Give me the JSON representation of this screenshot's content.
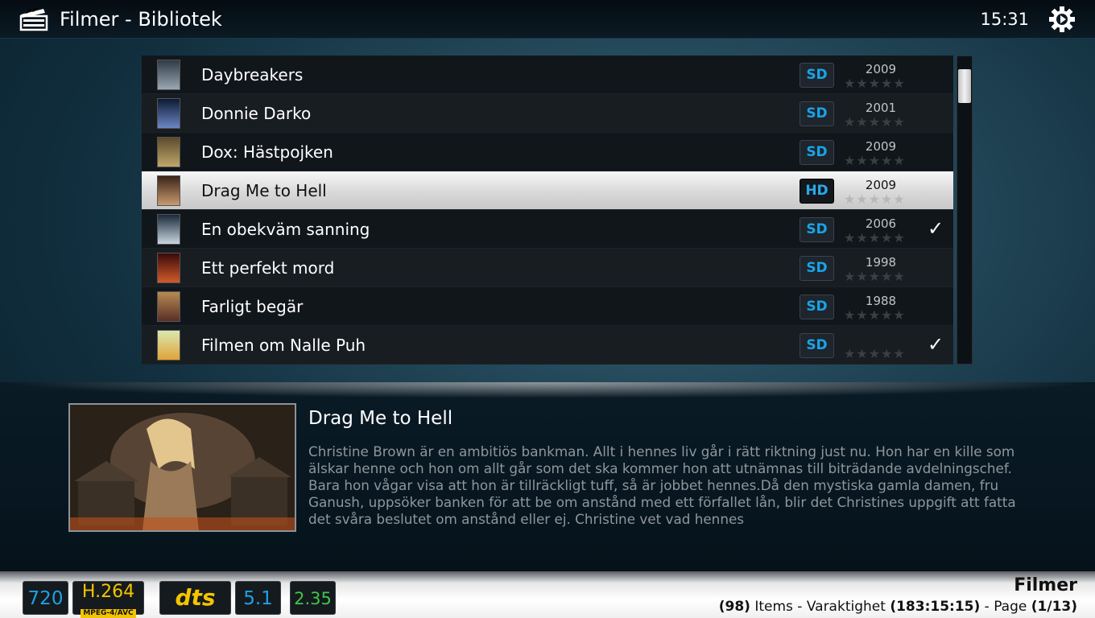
{
  "header": {
    "title": "Filmer - Bibliotek",
    "clock": "15:31",
    "app_icon": "clapperboard-icon",
    "settings_icon": "gear-icon"
  },
  "list": {
    "items": [
      {
        "title": "Daybreakers",
        "quality": "SD",
        "year": "2009",
        "rating": 0,
        "watched": false,
        "poster_colors": [
          "#2f3b46",
          "#9aa8b3"
        ]
      },
      {
        "title": "Donnie Darko",
        "quality": "SD",
        "year": "2001",
        "rating": 0,
        "watched": false,
        "poster_colors": [
          "#0d1a33",
          "#6c87c4"
        ]
      },
      {
        "title": "Dox: Hästpojken",
        "quality": "SD",
        "year": "2009",
        "rating": 0,
        "watched": false,
        "poster_colors": [
          "#5c4a2d",
          "#c0a76a"
        ]
      },
      {
        "title": "Drag Me to Hell",
        "quality": "HD",
        "year": "2009",
        "rating": 0,
        "watched": false,
        "selected": true,
        "poster_colors": [
          "#3a2418",
          "#c99a6e"
        ]
      },
      {
        "title": "En obekväm sanning",
        "quality": "SD",
        "year": "2006",
        "rating": 0,
        "watched": true,
        "poster_colors": [
          "#1a2a3a",
          "#c9d6e0"
        ]
      },
      {
        "title": "Ett perfekt mord",
        "quality": "SD",
        "year": "1998",
        "rating": 0,
        "watched": false,
        "poster_colors": [
          "#3a0a0a",
          "#d15a2a"
        ]
      },
      {
        "title": "Farligt begär",
        "quality": "SD",
        "year": "1988",
        "rating": 0,
        "watched": false,
        "poster_colors": [
          "#b48a53",
          "#5a2f26"
        ]
      },
      {
        "title": "Filmen om Nalle Puh",
        "quality": "SD",
        "year": "",
        "rating": 0,
        "watched": true,
        "poster_colors": [
          "#d9e8b0",
          "#e0a33a"
        ]
      }
    ],
    "star_glyphs": "★★★★★",
    "watched_glyph": "✓"
  },
  "info": {
    "title": "Drag Me to Hell",
    "plot": "Christine Brown är en ambitiös bankman. Allt i hennes liv går i rätt riktning just nu. Hon har en kille som älskar henne och hon om allt går som det ska kommer hon att utnämnas till biträdande avdelningschef. Bara hon vågar visa att hon är tillräckligt tuff, så är jobbet hennes.Då den mystiska gamla damen, fru Ganush, uppsöker banken för att be om anstånd med ett förfallet lån, blir det Christines uppgift att fatta det svåra beslutet om anstånd eller ej. Christine vet vad hennes"
  },
  "footer": {
    "flags": {
      "resolution": "720",
      "codec": "H.264",
      "codec_sub": "MPEG-4/AVC",
      "audio": "dts",
      "channels": "5.1",
      "aspect": "2.35"
    },
    "section": "Filmer",
    "items_count": "(98)",
    "items_label": "Items - Varaktighet",
    "duration": "(183:15:15)",
    "page_label": "- Page",
    "page": "(1/13)"
  }
}
